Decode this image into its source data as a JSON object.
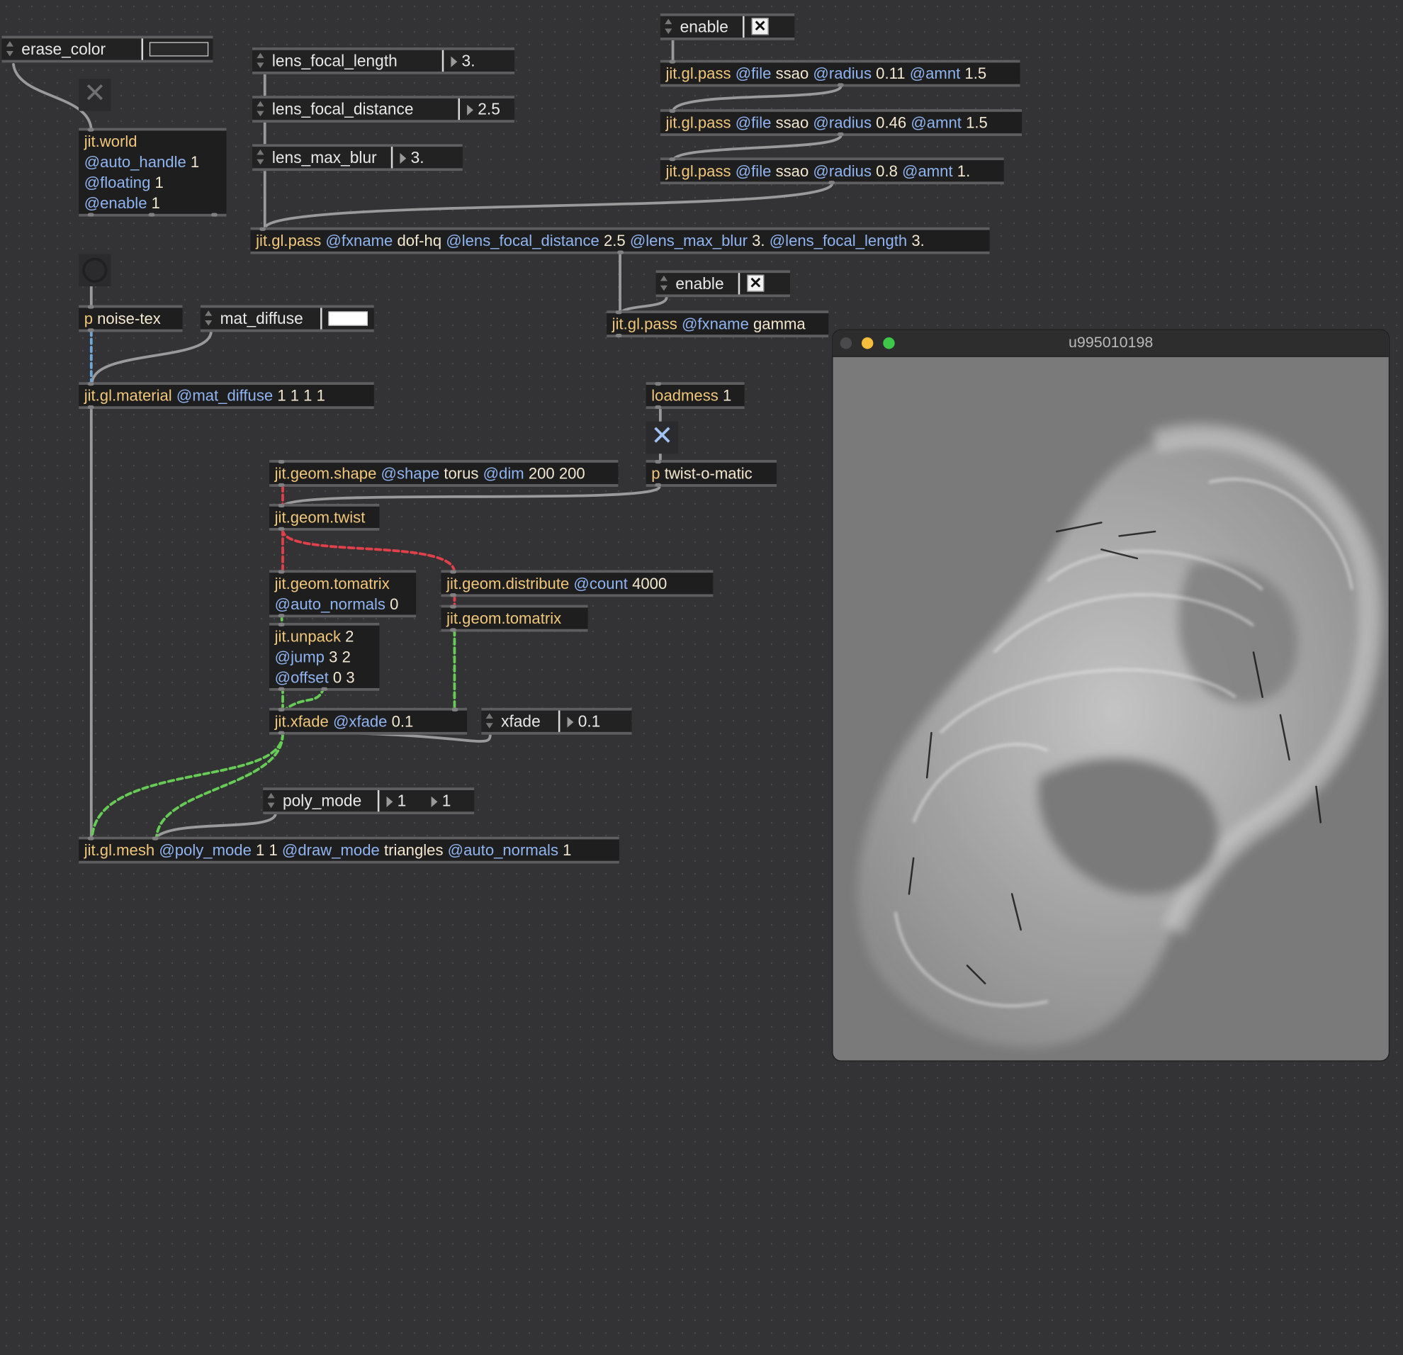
{
  "window": {
    "title": "u995010198"
  },
  "attrui": {
    "erase_color": {
      "name": "erase_color",
      "swatch": "#2a2a2b"
    },
    "lens_focal_length": {
      "name": "lens_focal_length",
      "value": "3."
    },
    "lens_focal_distance": {
      "name": "lens_focal_distance",
      "value": "2.5"
    },
    "lens_max_blur": {
      "name": "lens_max_blur",
      "value": "3."
    },
    "enable_top": {
      "name": "enable",
      "check": "✕"
    },
    "enable_mid": {
      "name": "enable",
      "check": "✕"
    },
    "mat_diffuse": {
      "name": "mat_diffuse",
      "swatch": "#ffffff"
    },
    "xfade": {
      "name": "xfade",
      "value": "0.1"
    },
    "poly_mode": {
      "name": "poly_mode",
      "value1": "1",
      "value2": "1"
    }
  },
  "objects": {
    "jit_world": {
      "class": "jit.world",
      "a1": "@auto_handle",
      "v1": "1",
      "a2": "@floating",
      "v2": "1",
      "a3": "@enable",
      "v3": "1"
    },
    "pass1": {
      "class": "jit.gl.pass",
      "a1": "@file",
      "v1": "ssao",
      "a2": "@radius",
      "v2": "0.11",
      "a3": "@amnt",
      "v3": "1.5"
    },
    "pass2": {
      "class": "jit.gl.pass",
      "a1": "@file",
      "v1": "ssao",
      "a2": "@radius",
      "v2": "0.46",
      "a3": "@amnt",
      "v3": "1.5"
    },
    "pass3": {
      "class": "jit.gl.pass",
      "a1": "@file",
      "v1": "ssao",
      "a2": "@radius",
      "v2": "0.8",
      "a3": "@amnt",
      "v3": "1."
    },
    "dof": {
      "class": "jit.gl.pass",
      "a1": "@fxname",
      "v1": "dof-hq",
      "a2": "@lens_focal_distance",
      "v2": "2.5",
      "a3": "@lens_max_blur",
      "v3": "3.",
      "a4": "@lens_focal_length",
      "v4": "3."
    },
    "gamma": {
      "class": "jit.gl.pass",
      "a1": "@fxname",
      "v1": "gamma"
    },
    "noise_tex": {
      "class": "p",
      "v1": "noise-tex"
    },
    "material": {
      "class": "jit.gl.material",
      "a1": "@mat_diffuse",
      "v1": "1 1 1 1"
    },
    "loadmess": {
      "class": "loadmess",
      "v1": "1"
    },
    "twist_o_matic": {
      "class": "p",
      "v1": "twist-o-matic"
    },
    "shape": {
      "class": "jit.geom.shape",
      "a1": "@shape",
      "v1": "torus",
      "a2": "@dim",
      "v2": "200 200"
    },
    "twist": {
      "class": "jit.geom.twist"
    },
    "tomatrix1": {
      "class": "jit.geom.tomatrix",
      "a1": "@auto_normals",
      "v1": "0"
    },
    "distribute": {
      "class": "jit.geom.distribute",
      "a1": "@count",
      "v1": "4000"
    },
    "tomatrix2": {
      "class": "jit.geom.tomatrix"
    },
    "unpack": {
      "class": "jit.unpack",
      "v1": "2",
      "a2": "@jump",
      "v2": "3 2",
      "a3": "@offset",
      "v3": "0 3"
    },
    "xfade_obj": {
      "class": "jit.xfade",
      "a1": "@xfade",
      "v1": "0.1"
    },
    "mesh": {
      "class": "jit.gl.mesh",
      "a1": "@poly_mode",
      "v1": "1 1",
      "a2": "@draw_mode",
      "v2": "triangles",
      "a3": "@auto_normals",
      "v3": "1"
    }
  },
  "colors": {
    "background": "#333335",
    "object_class": "#f0c77a",
    "attribute": "#8fb4f0",
    "value": "#f3e7cf",
    "cable_gray": "#9a9a9a",
    "cable_matrix_red": "#e0404a",
    "cable_geom_green": "#66cc55",
    "cable_texture_blue": "#6fa8d8"
  }
}
